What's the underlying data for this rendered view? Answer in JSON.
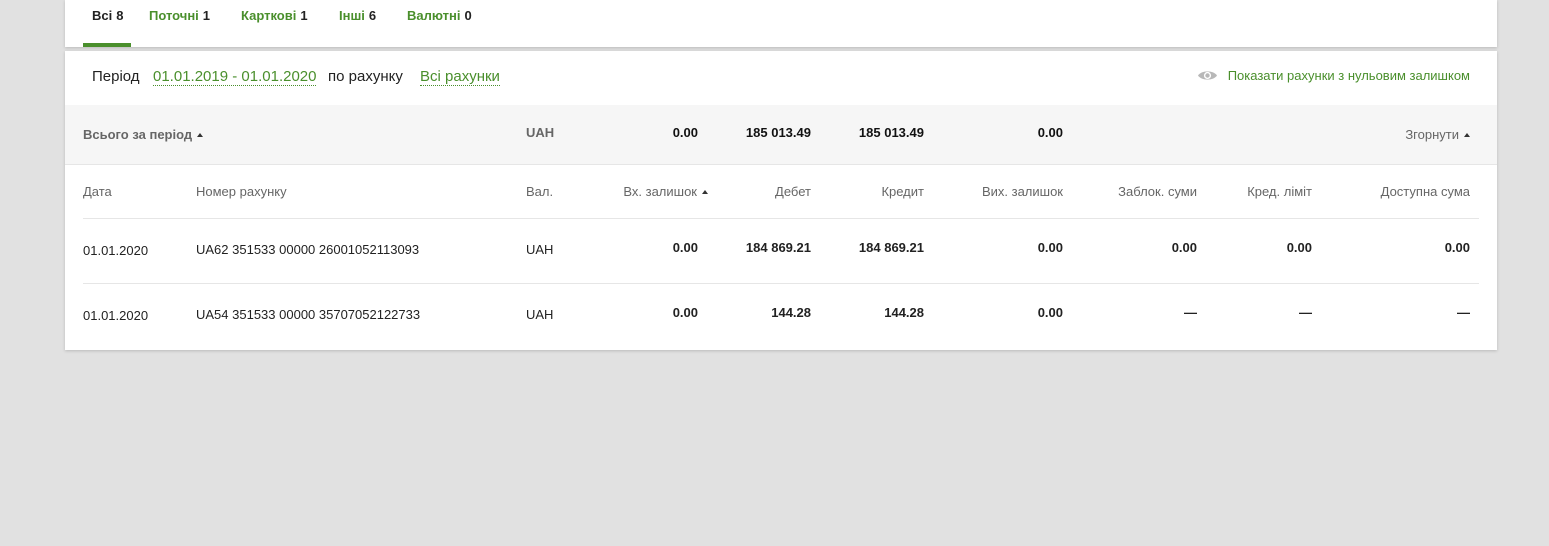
{
  "tabs": [
    {
      "label": "Всі",
      "count": "8"
    },
    {
      "label": "Поточні",
      "count": "1"
    },
    {
      "label": "Карткові",
      "count": "1"
    },
    {
      "label": "Інші",
      "count": "6"
    },
    {
      "label": "Валютні",
      "count": "0"
    }
  ],
  "filter": {
    "period_label": "Період",
    "period_value": "01.01.2019 - 01.01.2020",
    "account_label": "по рахунку",
    "account_value": "Всі рахунки",
    "zero_balance_toggle": "Показати рахунки з нульовим залишком"
  },
  "summary": {
    "label": "Всього за період",
    "currency": "UAH",
    "opening": "0.00",
    "debit": "185 013.49",
    "credit": "185 013.49",
    "closing": "0.00",
    "collapse": "Згорнути"
  },
  "columns": {
    "date": "Дата",
    "account": "Номер рахунку",
    "currency": "Вал.",
    "opening": "Вх. залишок",
    "debit": "Дебет",
    "credit": "Кредит",
    "closing": "Вих. залишок",
    "blocked": "Заблок. суми",
    "credit_limit": "Кред. ліміт",
    "available": "Доступна сума"
  },
  "rows": [
    {
      "date": "01.01.2020",
      "account": "UA62 351533 00000 26001052113093",
      "currency": "UAH",
      "opening": "0.00",
      "debit": "184 869.21",
      "credit": "184 869.21",
      "closing": "0.00",
      "blocked": "0.00",
      "credit_limit": "0.00",
      "available": "0.00"
    },
    {
      "date": "01.01.2020",
      "account": "UA54 351533 00000 35707052122733",
      "currency": "UAH",
      "opening": "0.00",
      "debit": "144.28",
      "credit": "144.28",
      "closing": "0.00",
      "blocked": "—",
      "credit_limit": "—",
      "available": "—"
    }
  ],
  "colors": {
    "accent": "#4a8f2c",
    "background": "#e1e1e1",
    "summary_bg": "#f6f6f6"
  },
  "icons": {
    "eye": "eye-icon",
    "sort": "sort-asc-icon",
    "collapse": "chevron-up-icon"
  }
}
